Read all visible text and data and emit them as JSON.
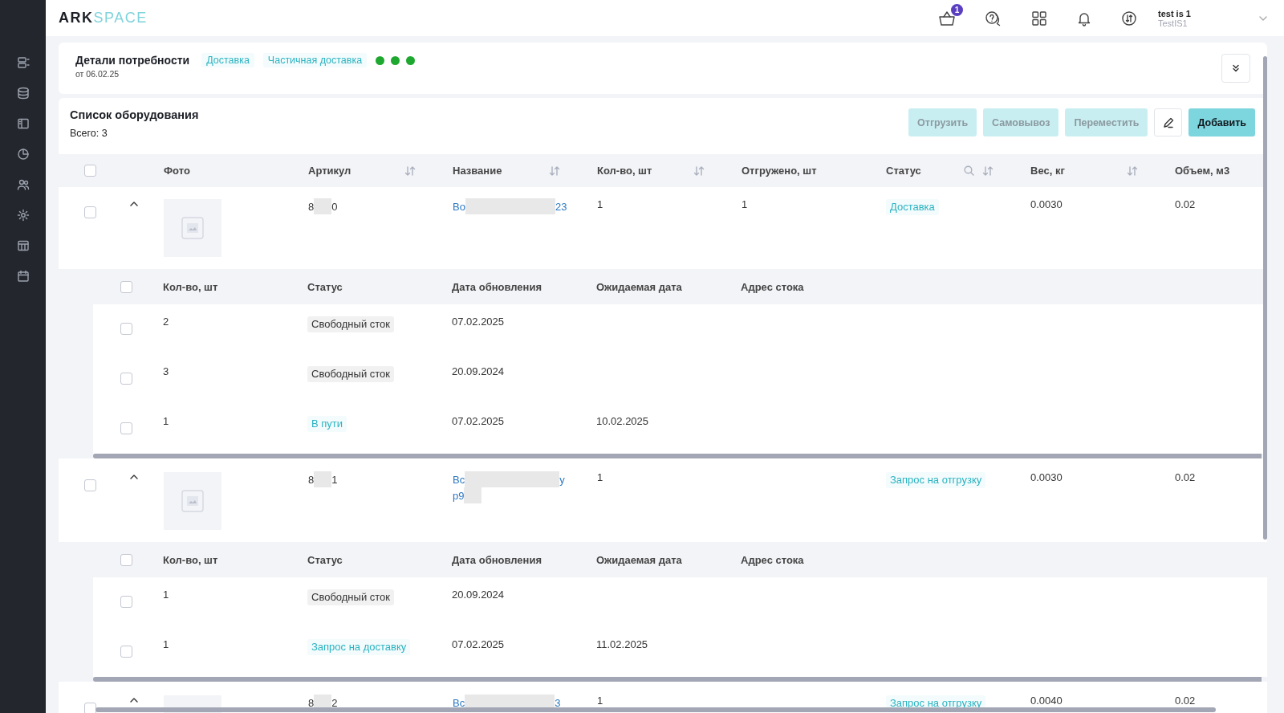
{
  "header": {
    "logo": {
      "part_1": "ARK",
      "part_2": "SPACE"
    },
    "cart_badge": "1",
    "user": {
      "name": "test is 1",
      "login": "TestIS1"
    }
  },
  "details": {
    "title": "Детали потребности",
    "date": "от 06.02.25",
    "tags": [
      "Доставка",
      "Частичная доставка"
    ],
    "dots": [
      {
        "color": "#1ea82f"
      },
      {
        "color": "#1ea82f"
      },
      {
        "color": "#1ea82f"
      }
    ]
  },
  "equipment": {
    "title": "Список оборудования",
    "total": "Всего: 3",
    "buttons": [
      {
        "label": "Отгрузить",
        "kind": "secondary",
        "disabled": true
      },
      {
        "label": "Самовывоз",
        "kind": "secondary",
        "disabled": true
      },
      {
        "label": "Переместить",
        "kind": "secondary",
        "disabled": true
      },
      {
        "kind": "edit",
        "disabled": false
      },
      {
        "label": "Добавить",
        "kind": "primary",
        "disabled": false
      }
    ],
    "table": {
      "select_all": {
        "checked": false
      },
      "columns": [
        {
          "label": "Фото",
          "sortable": false,
          "searchable": false
        },
        {
          "label": "Артикул",
          "sortable": true,
          "searchable": false
        },
        {
          "label": "Название",
          "sortable": true,
          "searchable": false
        },
        {
          "label": "Кол-во, шт",
          "sortable": true,
          "searchable": false
        },
        {
          "label": "Отгружено, шт",
          "sortable": false,
          "searchable": false
        },
        {
          "label": "Статус",
          "sortable": true,
          "searchable": true
        },
        {
          "label": "Вес, кг",
          "sortable": true,
          "searchable": false
        },
        {
          "label": "Объем, м3",
          "sortable": false,
          "searchable": false
        }
      ],
      "rows": [
        {
          "checked": false,
          "expanded": true,
          "article": [
            "8",
            "0"
          ],
          "name_lines": [
            [
              "Во",
              "23"
            ]
          ],
          "qty": "1",
          "shipped": "1",
          "status": {
            "text": "Доставка",
            "kind": "accent"
          },
          "weight": "0.0030",
          "volume": "0.02",
          "stock": {
            "select_all": {
              "checked": false
            },
            "columns": [
              "Кол-во, шт",
              "Статус",
              "Дата обновления",
              "Ожидаемая дата",
              "Адрес стока"
            ],
            "rows": [
              {
                "checked": false,
                "qty": "2",
                "status": {
                  "text": "Свободный сток",
                  "kind": "neutral"
                },
                "updated": "07.02.2025"
              },
              {
                "checked": false,
                "qty": "3",
                "status": {
                  "text": "Свободный сток",
                  "kind": "neutral"
                },
                "updated": "20.09.2024"
              },
              {
                "checked": false,
                "qty": "1",
                "status": {
                  "text": "В пути",
                  "kind": "accent"
                },
                "updated": "07.02.2025",
                "expected": "10.02.2025"
              }
            ]
          }
        },
        {
          "checked": false,
          "expanded": true,
          "article": [
            "8",
            "1"
          ],
          "name_lines": [
            [
              "Вс",
              "у"
            ],
            [
              "р9"
            ]
          ],
          "qty": "1",
          "status": {
            "text": "Запрос на отгрузку",
            "kind": "accent"
          },
          "weight": "0.0030",
          "volume": "0.02",
          "stock": {
            "select_all": {
              "checked": false
            },
            "columns": [
              "Кол-во, шт",
              "Статус",
              "Дата обновления",
              "Ожидаемая дата",
              "Адрес стока"
            ],
            "rows": [
              {
                "checked": false,
                "qty": "1",
                "status": {
                  "text": "Свободный сток",
                  "kind": "neutral"
                },
                "updated": "20.09.2024"
              },
              {
                "checked": false,
                "qty": "1",
                "status": {
                  "text": "Запрос на доставку",
                  "kind": "accent"
                },
                "updated": "07.02.2025",
                "expected": "11.02.2025"
              }
            ]
          }
        },
        {
          "checked": false,
          "expanded": true,
          "article": [
            "8",
            "2"
          ],
          "name_lines": [
            [
              "Вс",
              "3"
            ]
          ],
          "qty": "1",
          "status": {
            "text": "Запрос на отгрузку",
            "kind": "accent"
          },
          "weight": "0.0040",
          "volume": "0.02"
        }
      ]
    }
  }
}
